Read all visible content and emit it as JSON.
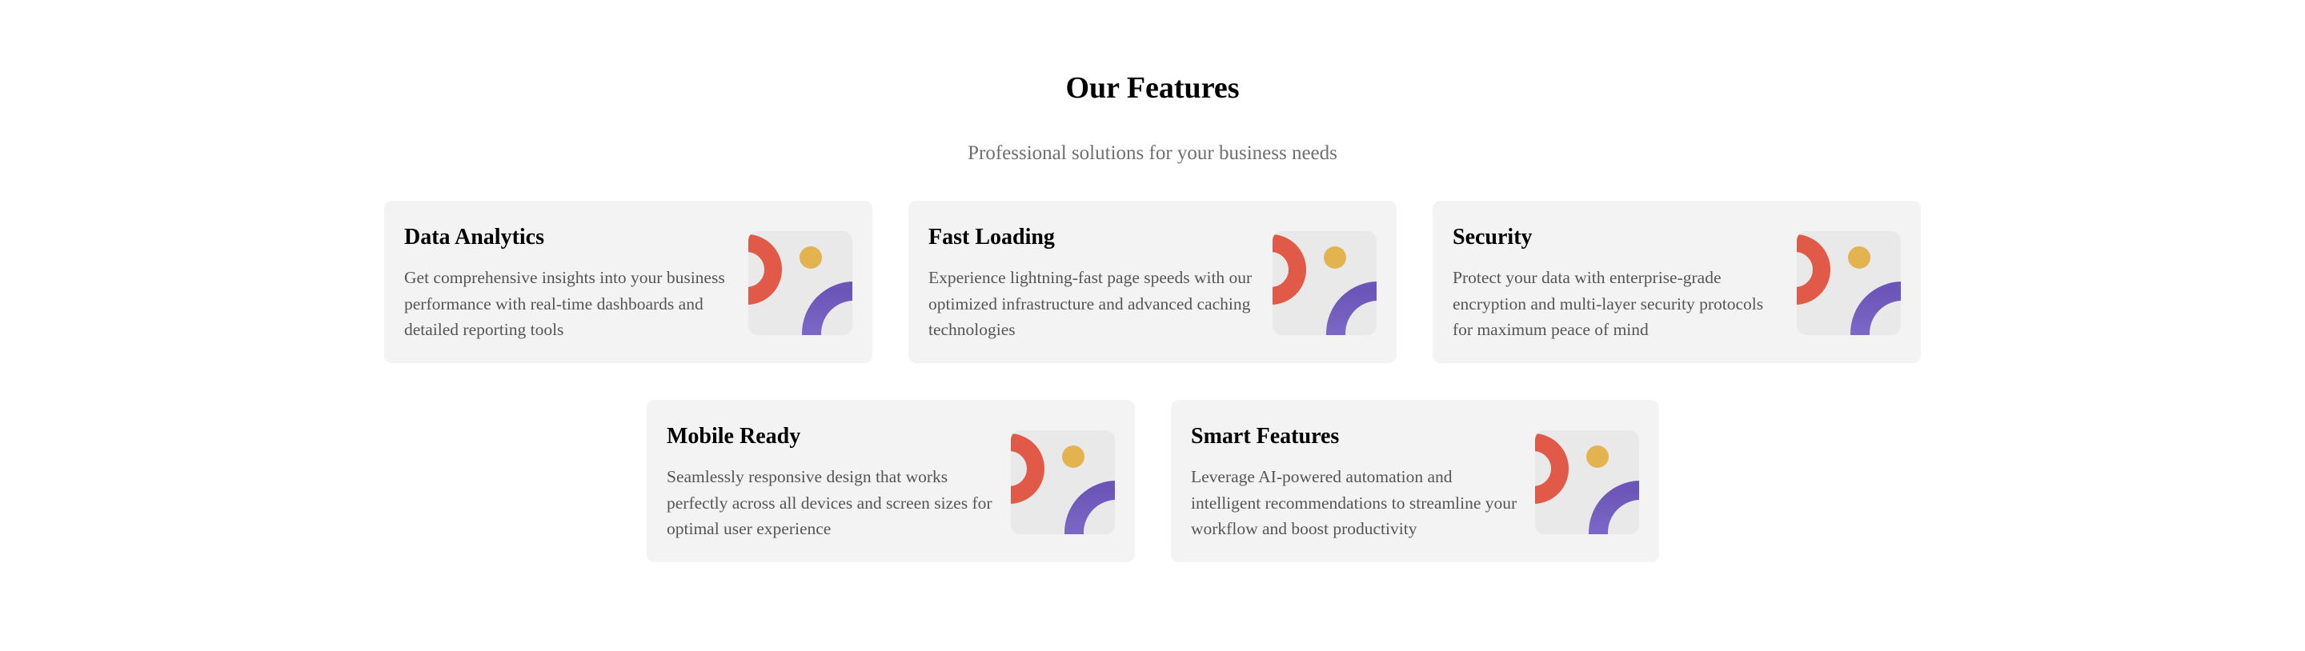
{
  "header": {
    "title": "Our Features",
    "subtitle": "Professional solutions for your business needs"
  },
  "colors": {
    "card_background": "#f3f3f3",
    "illustration_background": "#e9e9e9",
    "red_arc": "#e05a47",
    "yellow_dot": "#e3b34f",
    "purple_arc_dark": "#6c55b8",
    "purple_arc_light": "#8a7ad1"
  },
  "features": [
    {
      "title": "Data Analytics",
      "description": "Get comprehensive insights into your business performance with real-time dashboards and detailed reporting tools",
      "icon": "abstract-shapes-illustration"
    },
    {
      "title": "Fast Loading",
      "description": "Experience lightning-fast page speeds with our optimized infrastructure and advanced caching technologies",
      "icon": "abstract-shapes-illustration"
    },
    {
      "title": "Security",
      "description": "Protect your data with enterprise-grade encryption and multi-layer security protocols for maximum peace of mind",
      "icon": "abstract-shapes-illustration"
    },
    {
      "title": "Mobile Ready",
      "description": "Seamlessly responsive design that works perfectly across all devices and screen sizes for optimal user experience",
      "icon": "abstract-shapes-illustration"
    },
    {
      "title": "Smart Features",
      "description": "Leverage AI-powered automation and intelligent recommendations to streamline your workflow and boost productivity",
      "icon": "abstract-shapes-illustration"
    }
  ]
}
